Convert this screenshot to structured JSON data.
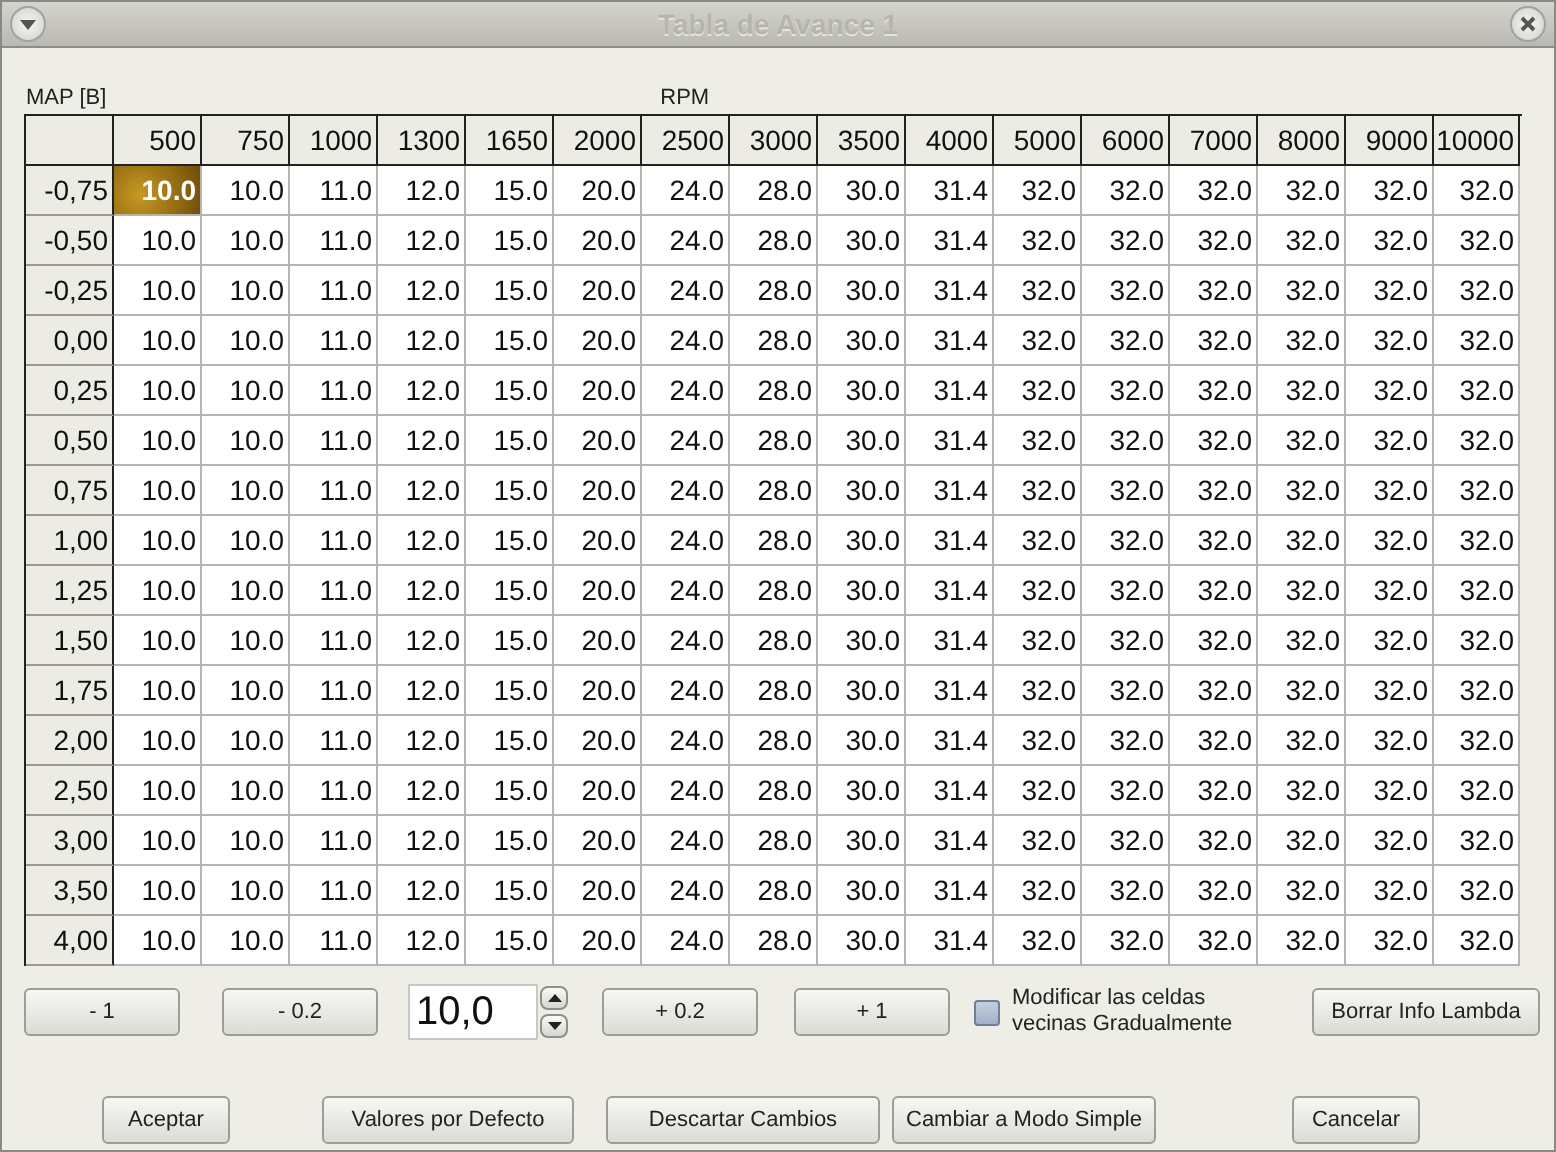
{
  "window": {
    "title": "Tabla de Avance 1"
  },
  "axis_labels": {
    "map": "MAP [B]",
    "rpm": "RPM"
  },
  "table": {
    "columns": [
      "500",
      "750",
      "1000",
      "1300",
      "1650",
      "2000",
      "2500",
      "3000",
      "3500",
      "4000",
      "5000",
      "6000",
      "7000",
      "8000",
      "9000",
      "10000"
    ],
    "rows": [
      {
        "map": "-0,75",
        "cells": [
          {
            "v": "10.0",
            "selected": true
          },
          {
            "v": "10.0",
            "selected": false
          },
          {
            "v": "11.0",
            "selected": false
          },
          {
            "v": "12.0",
            "selected": false
          },
          {
            "v": "15.0",
            "selected": false
          },
          {
            "v": "20.0",
            "selected": false
          },
          {
            "v": "24.0",
            "selected": false
          },
          {
            "v": "28.0",
            "selected": false
          },
          {
            "v": "30.0",
            "selected": false
          },
          {
            "v": "31.4",
            "selected": false
          },
          {
            "v": "32.0",
            "selected": false
          },
          {
            "v": "32.0",
            "selected": false
          },
          {
            "v": "32.0",
            "selected": false
          },
          {
            "v": "32.0",
            "selected": false
          },
          {
            "v": "32.0",
            "selected": false
          },
          {
            "v": "32.0",
            "selected": false
          }
        ]
      },
      {
        "map": "-0,50",
        "cells": [
          {
            "v": "10.0",
            "selected": false
          },
          {
            "v": "10.0",
            "selected": false
          },
          {
            "v": "11.0",
            "selected": false
          },
          {
            "v": "12.0",
            "selected": false
          },
          {
            "v": "15.0",
            "selected": false
          },
          {
            "v": "20.0",
            "selected": false
          },
          {
            "v": "24.0",
            "selected": false
          },
          {
            "v": "28.0",
            "selected": false
          },
          {
            "v": "30.0",
            "selected": false
          },
          {
            "v": "31.4",
            "selected": false
          },
          {
            "v": "32.0",
            "selected": false
          },
          {
            "v": "32.0",
            "selected": false
          },
          {
            "v": "32.0",
            "selected": false
          },
          {
            "v": "32.0",
            "selected": false
          },
          {
            "v": "32.0",
            "selected": false
          },
          {
            "v": "32.0",
            "selected": false
          }
        ]
      },
      {
        "map": "-0,25",
        "cells": [
          {
            "v": "10.0",
            "selected": false
          },
          {
            "v": "10.0",
            "selected": false
          },
          {
            "v": "11.0",
            "selected": false
          },
          {
            "v": "12.0",
            "selected": false
          },
          {
            "v": "15.0",
            "selected": false
          },
          {
            "v": "20.0",
            "selected": false
          },
          {
            "v": "24.0",
            "selected": false
          },
          {
            "v": "28.0",
            "selected": false
          },
          {
            "v": "30.0",
            "selected": false
          },
          {
            "v": "31.4",
            "selected": false
          },
          {
            "v": "32.0",
            "selected": false
          },
          {
            "v": "32.0",
            "selected": false
          },
          {
            "v": "32.0",
            "selected": false
          },
          {
            "v": "32.0",
            "selected": false
          },
          {
            "v": "32.0",
            "selected": false
          },
          {
            "v": "32.0",
            "selected": false
          }
        ]
      },
      {
        "map": "0,00",
        "cells": [
          {
            "v": "10.0",
            "selected": false
          },
          {
            "v": "10.0",
            "selected": false
          },
          {
            "v": "11.0",
            "selected": false
          },
          {
            "v": "12.0",
            "selected": false
          },
          {
            "v": "15.0",
            "selected": false
          },
          {
            "v": "20.0",
            "selected": false
          },
          {
            "v": "24.0",
            "selected": false
          },
          {
            "v": "28.0",
            "selected": false
          },
          {
            "v": "30.0",
            "selected": false
          },
          {
            "v": "31.4",
            "selected": false
          },
          {
            "v": "32.0",
            "selected": false
          },
          {
            "v": "32.0",
            "selected": false
          },
          {
            "v": "32.0",
            "selected": false
          },
          {
            "v": "32.0",
            "selected": false
          },
          {
            "v": "32.0",
            "selected": false
          },
          {
            "v": "32.0",
            "selected": false
          }
        ]
      },
      {
        "map": "0,25",
        "cells": [
          {
            "v": "10.0",
            "selected": false
          },
          {
            "v": "10.0",
            "selected": false
          },
          {
            "v": "11.0",
            "selected": false
          },
          {
            "v": "12.0",
            "selected": false
          },
          {
            "v": "15.0",
            "selected": false
          },
          {
            "v": "20.0",
            "selected": false
          },
          {
            "v": "24.0",
            "selected": false
          },
          {
            "v": "28.0",
            "selected": false
          },
          {
            "v": "30.0",
            "selected": false
          },
          {
            "v": "31.4",
            "selected": false
          },
          {
            "v": "32.0",
            "selected": false
          },
          {
            "v": "32.0",
            "selected": false
          },
          {
            "v": "32.0",
            "selected": false
          },
          {
            "v": "32.0",
            "selected": false
          },
          {
            "v": "32.0",
            "selected": false
          },
          {
            "v": "32.0",
            "selected": false
          }
        ]
      },
      {
        "map": "0,50",
        "cells": [
          {
            "v": "10.0",
            "selected": false
          },
          {
            "v": "10.0",
            "selected": false
          },
          {
            "v": "11.0",
            "selected": false
          },
          {
            "v": "12.0",
            "selected": false
          },
          {
            "v": "15.0",
            "selected": false
          },
          {
            "v": "20.0",
            "selected": false
          },
          {
            "v": "24.0",
            "selected": false
          },
          {
            "v": "28.0",
            "selected": false
          },
          {
            "v": "30.0",
            "selected": false
          },
          {
            "v": "31.4",
            "selected": false
          },
          {
            "v": "32.0",
            "selected": false
          },
          {
            "v": "32.0",
            "selected": false
          },
          {
            "v": "32.0",
            "selected": false
          },
          {
            "v": "32.0",
            "selected": false
          },
          {
            "v": "32.0",
            "selected": false
          },
          {
            "v": "32.0",
            "selected": false
          }
        ]
      },
      {
        "map": "0,75",
        "cells": [
          {
            "v": "10.0",
            "selected": false
          },
          {
            "v": "10.0",
            "selected": false
          },
          {
            "v": "11.0",
            "selected": false
          },
          {
            "v": "12.0",
            "selected": false
          },
          {
            "v": "15.0",
            "selected": false
          },
          {
            "v": "20.0",
            "selected": false
          },
          {
            "v": "24.0",
            "selected": false
          },
          {
            "v": "28.0",
            "selected": false
          },
          {
            "v": "30.0",
            "selected": false
          },
          {
            "v": "31.4",
            "selected": false
          },
          {
            "v": "32.0",
            "selected": false
          },
          {
            "v": "32.0",
            "selected": false
          },
          {
            "v": "32.0",
            "selected": false
          },
          {
            "v": "32.0",
            "selected": false
          },
          {
            "v": "32.0",
            "selected": false
          },
          {
            "v": "32.0",
            "selected": false
          }
        ]
      },
      {
        "map": "1,00",
        "cells": [
          {
            "v": "10.0",
            "selected": false
          },
          {
            "v": "10.0",
            "selected": false
          },
          {
            "v": "11.0",
            "selected": false
          },
          {
            "v": "12.0",
            "selected": false
          },
          {
            "v": "15.0",
            "selected": false
          },
          {
            "v": "20.0",
            "selected": false
          },
          {
            "v": "24.0",
            "selected": false
          },
          {
            "v": "28.0",
            "selected": false
          },
          {
            "v": "30.0",
            "selected": false
          },
          {
            "v": "31.4",
            "selected": false
          },
          {
            "v": "32.0",
            "selected": false
          },
          {
            "v": "32.0",
            "selected": false
          },
          {
            "v": "32.0",
            "selected": false
          },
          {
            "v": "32.0",
            "selected": false
          },
          {
            "v": "32.0",
            "selected": false
          },
          {
            "v": "32.0",
            "selected": false
          }
        ]
      },
      {
        "map": "1,25",
        "cells": [
          {
            "v": "10.0",
            "selected": false
          },
          {
            "v": "10.0",
            "selected": false
          },
          {
            "v": "11.0",
            "selected": false
          },
          {
            "v": "12.0",
            "selected": false
          },
          {
            "v": "15.0",
            "selected": false
          },
          {
            "v": "20.0",
            "selected": false
          },
          {
            "v": "24.0",
            "selected": false
          },
          {
            "v": "28.0",
            "selected": false
          },
          {
            "v": "30.0",
            "selected": false
          },
          {
            "v": "31.4",
            "selected": false
          },
          {
            "v": "32.0",
            "selected": false
          },
          {
            "v": "32.0",
            "selected": false
          },
          {
            "v": "32.0",
            "selected": false
          },
          {
            "v": "32.0",
            "selected": false
          },
          {
            "v": "32.0",
            "selected": false
          },
          {
            "v": "32.0",
            "selected": false
          }
        ]
      },
      {
        "map": "1,50",
        "cells": [
          {
            "v": "10.0",
            "selected": false
          },
          {
            "v": "10.0",
            "selected": false
          },
          {
            "v": "11.0",
            "selected": false
          },
          {
            "v": "12.0",
            "selected": false
          },
          {
            "v": "15.0",
            "selected": false
          },
          {
            "v": "20.0",
            "selected": false
          },
          {
            "v": "24.0",
            "selected": false
          },
          {
            "v": "28.0",
            "selected": false
          },
          {
            "v": "30.0",
            "selected": false
          },
          {
            "v": "31.4",
            "selected": false
          },
          {
            "v": "32.0",
            "selected": false
          },
          {
            "v": "32.0",
            "selected": false
          },
          {
            "v": "32.0",
            "selected": false
          },
          {
            "v": "32.0",
            "selected": false
          },
          {
            "v": "32.0",
            "selected": false
          },
          {
            "v": "32.0",
            "selected": false
          }
        ]
      },
      {
        "map": "1,75",
        "cells": [
          {
            "v": "10.0",
            "selected": false
          },
          {
            "v": "10.0",
            "selected": false
          },
          {
            "v": "11.0",
            "selected": false
          },
          {
            "v": "12.0",
            "selected": false
          },
          {
            "v": "15.0",
            "selected": false
          },
          {
            "v": "20.0",
            "selected": false
          },
          {
            "v": "24.0",
            "selected": false
          },
          {
            "v": "28.0",
            "selected": false
          },
          {
            "v": "30.0",
            "selected": false
          },
          {
            "v": "31.4",
            "selected": false
          },
          {
            "v": "32.0",
            "selected": false
          },
          {
            "v": "32.0",
            "selected": false
          },
          {
            "v": "32.0",
            "selected": false
          },
          {
            "v": "32.0",
            "selected": false
          },
          {
            "v": "32.0",
            "selected": false
          },
          {
            "v": "32.0",
            "selected": false
          }
        ]
      },
      {
        "map": "2,00",
        "cells": [
          {
            "v": "10.0",
            "selected": false
          },
          {
            "v": "10.0",
            "selected": false
          },
          {
            "v": "11.0",
            "selected": false
          },
          {
            "v": "12.0",
            "selected": false
          },
          {
            "v": "15.0",
            "selected": false
          },
          {
            "v": "20.0",
            "selected": false
          },
          {
            "v": "24.0",
            "selected": false
          },
          {
            "v": "28.0",
            "selected": false
          },
          {
            "v": "30.0",
            "selected": false
          },
          {
            "v": "31.4",
            "selected": false
          },
          {
            "v": "32.0",
            "selected": false
          },
          {
            "v": "32.0",
            "selected": false
          },
          {
            "v": "32.0",
            "selected": false
          },
          {
            "v": "32.0",
            "selected": false
          },
          {
            "v": "32.0",
            "selected": false
          },
          {
            "v": "32.0",
            "selected": false
          }
        ]
      },
      {
        "map": "2,50",
        "cells": [
          {
            "v": "10.0",
            "selected": false
          },
          {
            "v": "10.0",
            "selected": false
          },
          {
            "v": "11.0",
            "selected": false
          },
          {
            "v": "12.0",
            "selected": false
          },
          {
            "v": "15.0",
            "selected": false
          },
          {
            "v": "20.0",
            "selected": false
          },
          {
            "v": "24.0",
            "selected": false
          },
          {
            "v": "28.0",
            "selected": false
          },
          {
            "v": "30.0",
            "selected": false
          },
          {
            "v": "31.4",
            "selected": false
          },
          {
            "v": "32.0",
            "selected": false
          },
          {
            "v": "32.0",
            "selected": false
          },
          {
            "v": "32.0",
            "selected": false
          },
          {
            "v": "32.0",
            "selected": false
          },
          {
            "v": "32.0",
            "selected": false
          },
          {
            "v": "32.0",
            "selected": false
          }
        ]
      },
      {
        "map": "3,00",
        "cells": [
          {
            "v": "10.0",
            "selected": false
          },
          {
            "v": "10.0",
            "selected": false
          },
          {
            "v": "11.0",
            "selected": false
          },
          {
            "v": "12.0",
            "selected": false
          },
          {
            "v": "15.0",
            "selected": false
          },
          {
            "v": "20.0",
            "selected": false
          },
          {
            "v": "24.0",
            "selected": false
          },
          {
            "v": "28.0",
            "selected": false
          },
          {
            "v": "30.0",
            "selected": false
          },
          {
            "v": "31.4",
            "selected": false
          },
          {
            "v": "32.0",
            "selected": false
          },
          {
            "v": "32.0",
            "selected": false
          },
          {
            "v": "32.0",
            "selected": false
          },
          {
            "v": "32.0",
            "selected": false
          },
          {
            "v": "32.0",
            "selected": false
          },
          {
            "v": "32.0",
            "selected": false
          }
        ]
      },
      {
        "map": "3,50",
        "cells": [
          {
            "v": "10.0",
            "selected": false
          },
          {
            "v": "10.0",
            "selected": false
          },
          {
            "v": "11.0",
            "selected": false
          },
          {
            "v": "12.0",
            "selected": false
          },
          {
            "v": "15.0",
            "selected": false
          },
          {
            "v": "20.0",
            "selected": false
          },
          {
            "v": "24.0",
            "selected": false
          },
          {
            "v": "28.0",
            "selected": false
          },
          {
            "v": "30.0",
            "selected": false
          },
          {
            "v": "31.4",
            "selected": false
          },
          {
            "v": "32.0",
            "selected": false
          },
          {
            "v": "32.0",
            "selected": false
          },
          {
            "v": "32.0",
            "selected": false
          },
          {
            "v": "32.0",
            "selected": false
          },
          {
            "v": "32.0",
            "selected": false
          },
          {
            "v": "32.0",
            "selected": false
          }
        ]
      },
      {
        "map": "4,00",
        "cells": [
          {
            "v": "10.0",
            "selected": false
          },
          {
            "v": "10.0",
            "selected": false
          },
          {
            "v": "11.0",
            "selected": false
          },
          {
            "v": "12.0",
            "selected": false
          },
          {
            "v": "15.0",
            "selected": false
          },
          {
            "v": "20.0",
            "selected": false
          },
          {
            "v": "24.0",
            "selected": false
          },
          {
            "v": "28.0",
            "selected": false
          },
          {
            "v": "30.0",
            "selected": false
          },
          {
            "v": "31.4",
            "selected": false
          },
          {
            "v": "32.0",
            "selected": false
          },
          {
            "v": "32.0",
            "selected": false
          },
          {
            "v": "32.0",
            "selected": false
          },
          {
            "v": "32.0",
            "selected": false
          },
          {
            "v": "32.0",
            "selected": false
          },
          {
            "v": "32.0",
            "selected": false
          }
        ]
      }
    ]
  },
  "adjust_buttons": [
    "- 1",
    "- 0.2",
    "+ 0.2",
    "+ 1"
  ],
  "value_field": {
    "value": "10,0"
  },
  "gradual_checkbox": {
    "label": "Modificar las celdas vecinas Gradualmente",
    "checked": false
  },
  "lambda_button": "Borrar Info Lambda",
  "footer_buttons": [
    "Aceptar",
    "Valores por Defecto",
    "Descartar Cambios",
    "Cambiar a Modo Simple",
    "Cancelar"
  ]
}
